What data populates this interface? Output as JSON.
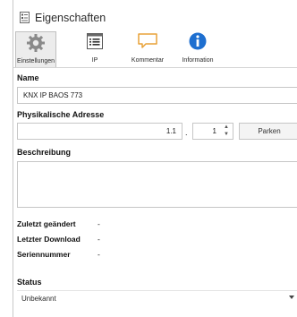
{
  "window": {
    "title": "Eigenschaften",
    "title_icon": "properties-doc-icon"
  },
  "tabs": [
    {
      "label": "Einstellungen",
      "icon": "gear-icon",
      "active": true
    },
    {
      "label": "IP",
      "icon": "ip-list-icon",
      "active": false
    },
    {
      "label": "Kommentar",
      "icon": "comment-icon",
      "active": false
    },
    {
      "label": "Information",
      "icon": "info-icon",
      "active": false
    }
  ],
  "name": {
    "label": "Name",
    "value": "KNX IP BAOS 773"
  },
  "address": {
    "label": "Physikalische Adresse",
    "area_line": "1.1",
    "separator": ".",
    "device": "1",
    "park_label": "Parken"
  },
  "description": {
    "label": "Beschreibung",
    "value": ""
  },
  "info": {
    "last_modified_label": "Zuletzt geändert",
    "last_modified_value": "-",
    "last_download_label": "Letzter Download",
    "last_download_value": "-",
    "serial_label": "Seriennummer",
    "serial_value": "-"
  },
  "status": {
    "label": "Status",
    "value": "Unbekannt"
  },
  "colors": {
    "accent_blue": "#1e6fd0",
    "comment_orange": "#e8a238",
    "border": "#c6c6c6"
  }
}
